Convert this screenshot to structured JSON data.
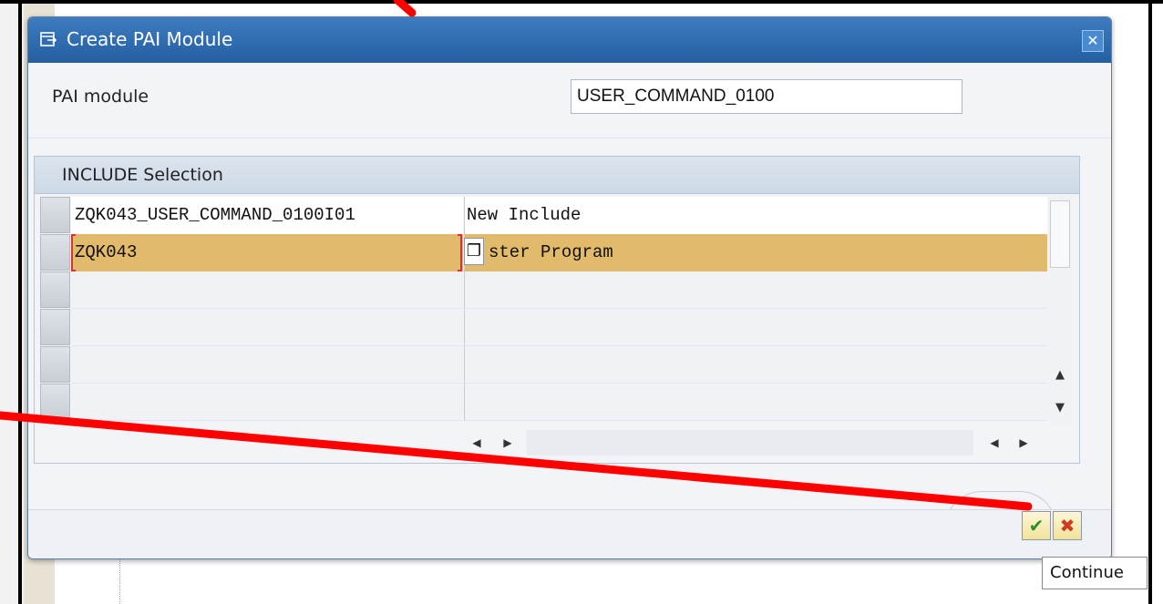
{
  "dialog": {
    "title": "Create PAI Module",
    "close_glyph": "✕",
    "field_label": "PAI module",
    "field_value": "USER_COMMAND_0100"
  },
  "include_selection": {
    "title": "INCLUDE Selection",
    "rows": [
      {
        "name": "ZQK043_USER_COMMAND_0100I01",
        "description": "New Include",
        "selected": false
      },
      {
        "name": "ZQK043",
        "description": "Master Program",
        "description_visible": "ster Program",
        "selected": true
      }
    ]
  },
  "buttons": {
    "continue_glyph": "✔",
    "cancel_glyph": "✖"
  },
  "tooltip": "Continue",
  "colors": {
    "title_bar": "#2d6aae",
    "selected_row": "#e2ba6b",
    "annotation": "#ff0000"
  }
}
